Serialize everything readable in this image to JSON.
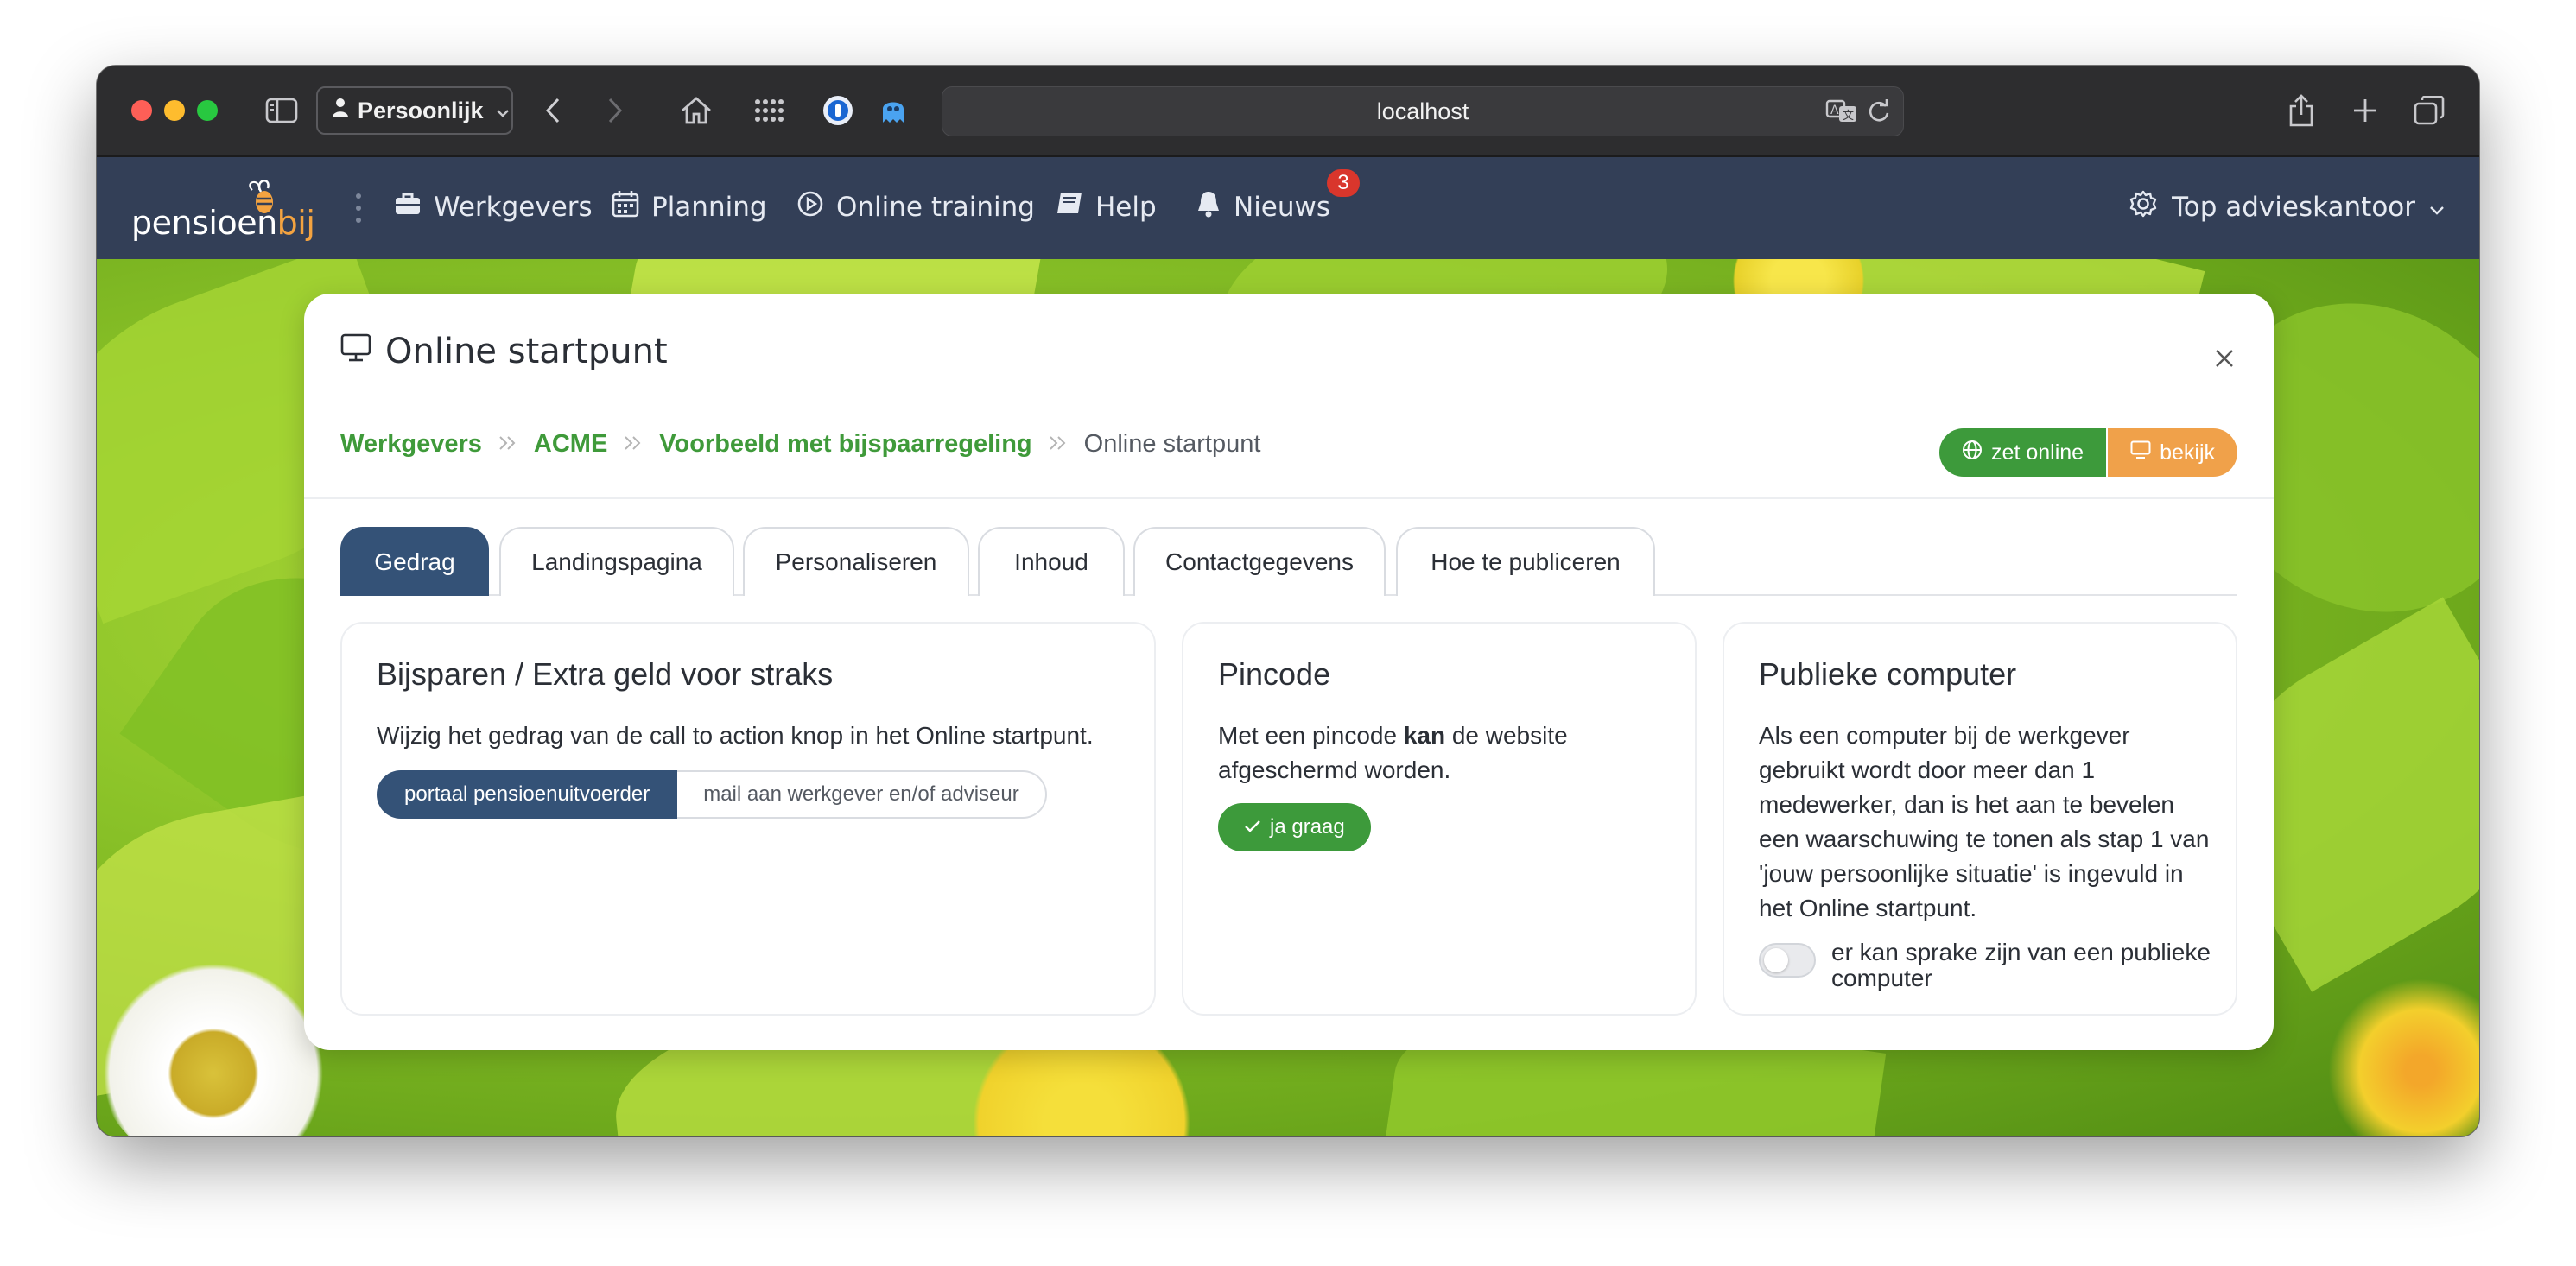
{
  "browser": {
    "profile_label": "Persoonlijk",
    "url": "localhost"
  },
  "app": {
    "logo_main": "pensioen",
    "logo_accent": "bij",
    "nav": [
      {
        "label": "Werkgevers",
        "icon": "briefcase-icon"
      },
      {
        "label": "Planning",
        "icon": "calendar-icon"
      },
      {
        "label": "Online training",
        "icon": "play-circle-icon"
      },
      {
        "label": "Help",
        "icon": "book-icon"
      },
      {
        "label": "Nieuws",
        "icon": "bell-icon"
      }
    ],
    "news_badge": "3",
    "account_label": "Top advieskantoor"
  },
  "card": {
    "title": "Online startpunt",
    "breadcrumb": [
      "Werkgevers",
      "ACME",
      "Voorbeeld met bijspaarregeling",
      "Online startpunt"
    ],
    "btn_online": "zet online",
    "btn_view": "bekijk",
    "tabs": [
      "Gedrag",
      "Landingspagina",
      "Personaliseren",
      "Inhoud",
      "Contactgegevens",
      "Hoe te publiceren"
    ],
    "active_tab": "Gedrag"
  },
  "panels": {
    "bijsparen": {
      "title": "Bijsparen / Extra geld voor straks",
      "text": "Wijzig het gedrag van de call to action knop in het Online startpunt.",
      "option_a": "portaal pensioenuitvoerder",
      "option_b": "mail aan werkgever en/of adviseur",
      "selected": "portaal pensioenuitvoerder"
    },
    "pincode": {
      "title": "Pincode",
      "text_before": "Met een pincode ",
      "text_bold": "kan",
      "text_after": " de website afgeschermd worden.",
      "button": "ja graag"
    },
    "publiek": {
      "title": "Publieke computer",
      "text": "Als een computer bij de werkgever gebruikt wordt door meer dan 1 medewerker, dan is het aan te bevelen een waarschuwing te tonen als stap 1 van 'jouw persoonlijke situatie' is ingevuld in het Online startpunt.",
      "toggle_label": "er kan sprake zijn van een publieke computer",
      "toggle_on": false
    }
  },
  "colors": {
    "nav_bg": "#333f57",
    "primary": "#345277",
    "success": "#3d9a3b",
    "warning": "#f0a14a",
    "badge": "#d9362c"
  }
}
